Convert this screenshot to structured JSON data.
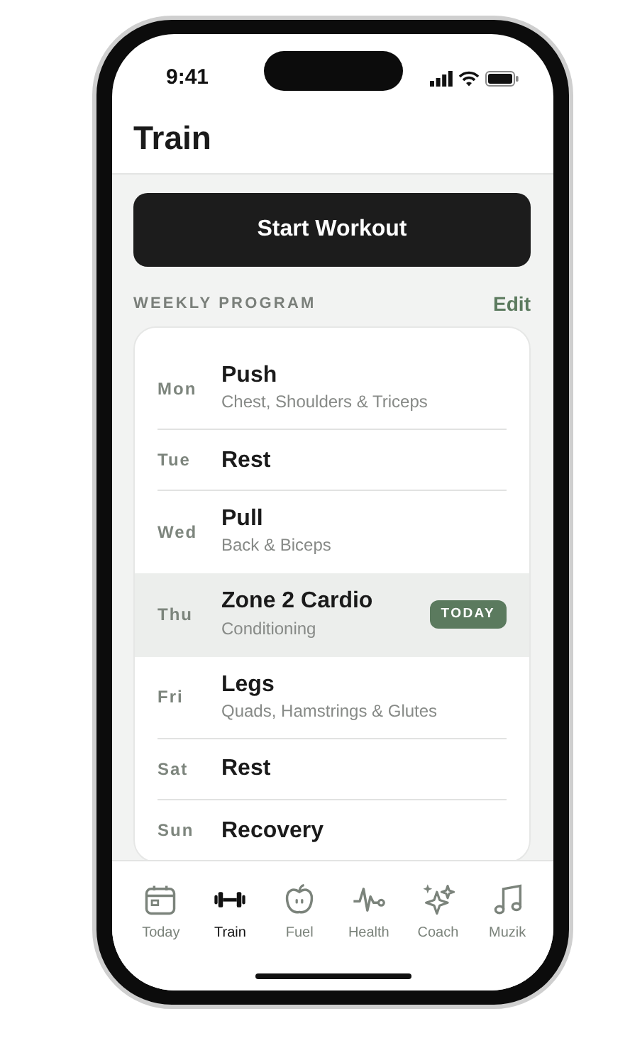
{
  "status_bar": {
    "time": "9:41"
  },
  "header": {
    "title": "Train"
  },
  "start_button": {
    "label": "Start Workout"
  },
  "program": {
    "heading": "WEEKLY PROGRAM",
    "action": "Edit",
    "days": [
      {
        "day": "Mon",
        "title": "Push",
        "subtitle": "Chest, Shoulders & Triceps",
        "selected": false
      },
      {
        "day": "Tue",
        "title": "Rest",
        "selected": false
      },
      {
        "day": "Wed",
        "title": "Pull",
        "subtitle": "Back & Biceps",
        "selected": false
      },
      {
        "day": "Thu",
        "title": "Zone 2 Cardio",
        "subtitle": "Conditioning",
        "selected": true,
        "badge": "TODAY"
      },
      {
        "day": "Fri",
        "title": "Legs",
        "subtitle": "Quads, Hamstrings & Glutes",
        "selected": false
      },
      {
        "day": "Sat",
        "title": "Rest",
        "selected": false
      },
      {
        "day": "Sun",
        "title": "Recovery",
        "selected": false
      }
    ]
  },
  "tab_bar": [
    {
      "label": "Today",
      "kind": "calendar",
      "selected": false
    },
    {
      "label": "Train",
      "kind": "dumbbell",
      "selected": true
    },
    {
      "label": "Fuel",
      "kind": "apple",
      "selected": false
    },
    {
      "label": "Health",
      "kind": "pulse",
      "selected": false
    },
    {
      "label": "Coach",
      "kind": "sparkles",
      "selected": false
    },
    {
      "label": "Muzik",
      "kind": "music",
      "selected": false
    }
  ]
}
